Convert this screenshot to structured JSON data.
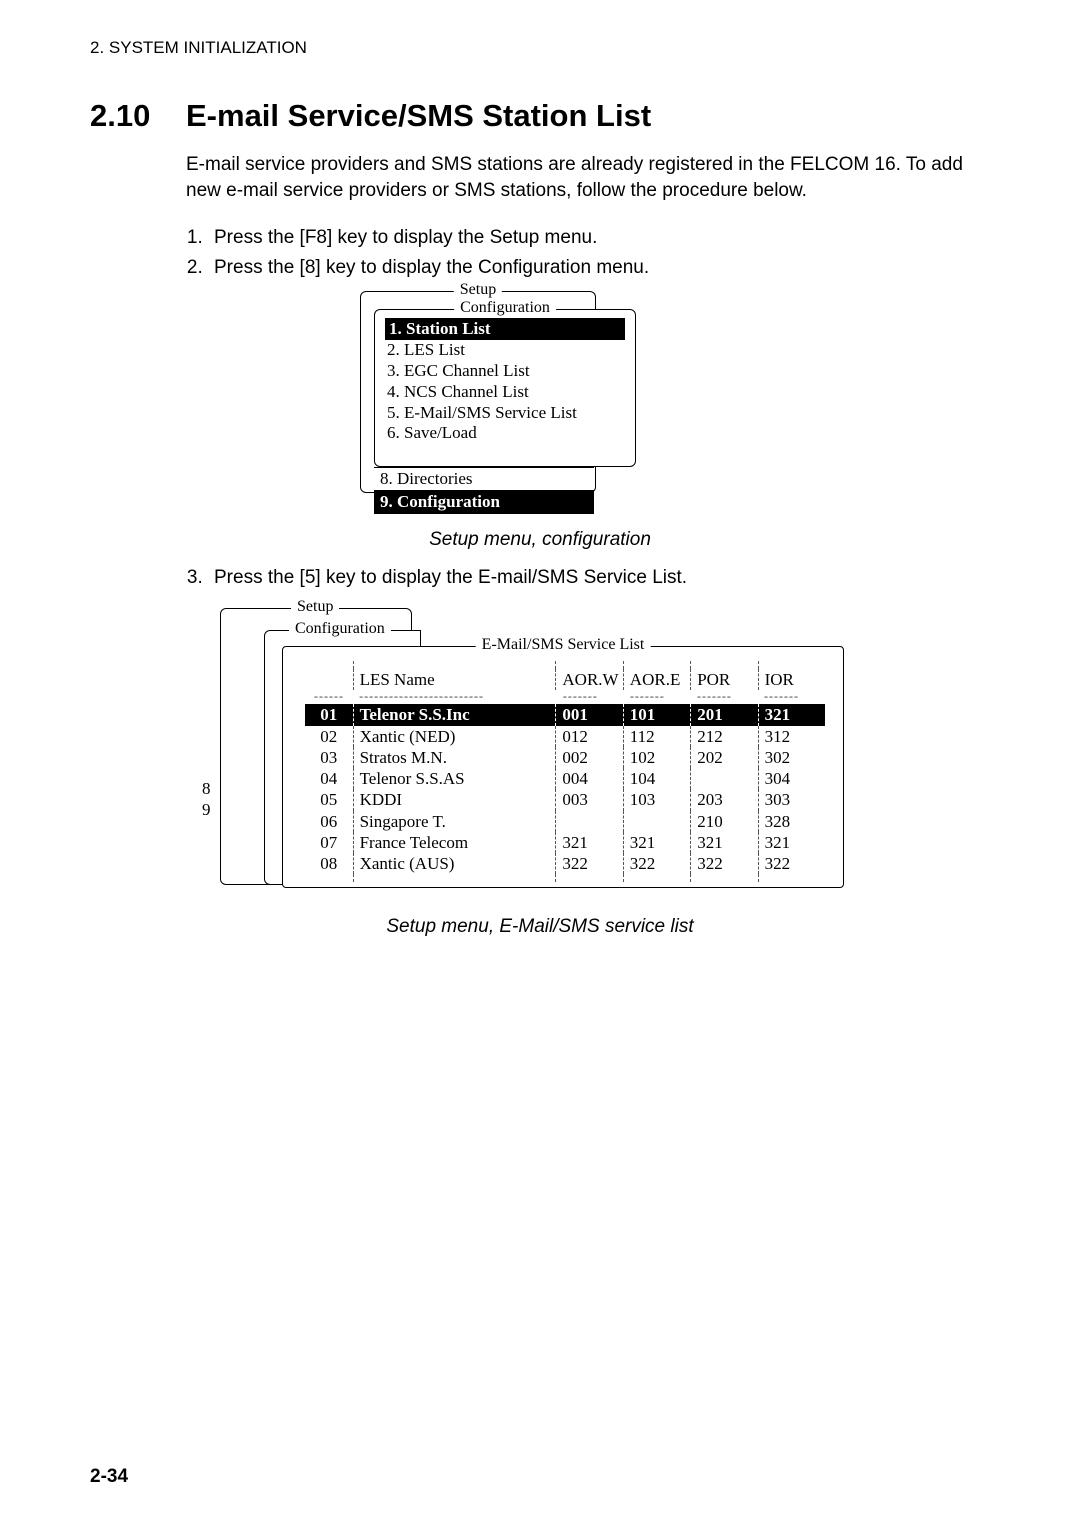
{
  "header": "2. SYSTEM INITIALIZATION",
  "section": {
    "number": "2.10",
    "title": "E-mail Service/SMS Station List"
  },
  "intro": "E-mail service providers and SMS stations are already registered in the FELCOM 16. To add new e-mail service providers or SMS stations, follow the procedure below.",
  "steps12": [
    "Press the [F8] key to display the Setup menu.",
    "Press the [8] key to display the Configuration menu."
  ],
  "fig1": {
    "setup_legend": "Setup",
    "config_legend": "Configuration",
    "items": [
      "1. Station List",
      "2. LES List",
      "3. EGC Channel List",
      "4. NCS Channel List",
      "5. E-Mail/SMS Service List",
      "6. Save/Load"
    ],
    "below1": "8. Directories",
    "below2": "9. Configuration",
    "caption": "Setup menu, configuration"
  },
  "step3": "Press the [5] key to display the E-mail/SMS Service List.",
  "fig2": {
    "setup_legend": "Setup",
    "config_legend": "Configuration",
    "list_legend": "E-Mail/SMS Service List",
    "side8": "8",
    "side9": "9",
    "caption": "Setup menu, E-Mail/SMS service list"
  },
  "chart_data": {
    "type": "table",
    "columns": [
      "",
      "LES Name",
      "AOR.W",
      "AOR.E",
      "POR",
      "IOR"
    ],
    "rows": [
      {
        "id": "01",
        "name": "Telenor S.S.Inc",
        "aorw": "001",
        "aore": "101",
        "por": "201",
        "ior": "321",
        "selected": true
      },
      {
        "id": "02",
        "name": "Xantic (NED)",
        "aorw": "012",
        "aore": "112",
        "por": "212",
        "ior": "312"
      },
      {
        "id": "03",
        "name": "Stratos M.N.",
        "aorw": "002",
        "aore": "102",
        "por": "202",
        "ior": "302"
      },
      {
        "id": "04",
        "name": "Telenor S.S.AS",
        "aorw": "004",
        "aore": "104",
        "por": "",
        "ior": "304"
      },
      {
        "id": "05",
        "name": "KDDI",
        "aorw": "003",
        "aore": "103",
        "por": "203",
        "ior": "303"
      },
      {
        "id": "06",
        "name": "Singapore T.",
        "aorw": "",
        "aore": "",
        "por": "210",
        "ior": "328"
      },
      {
        "id": "07",
        "name": "France Telecom",
        "aorw": "321",
        "aore": "321",
        "por": "321",
        "ior": "321"
      },
      {
        "id": "08",
        "name": "Xantic (AUS)",
        "aorw": "322",
        "aore": "322",
        "por": "322",
        "ior": "322"
      }
    ]
  },
  "page_number": "2-34"
}
